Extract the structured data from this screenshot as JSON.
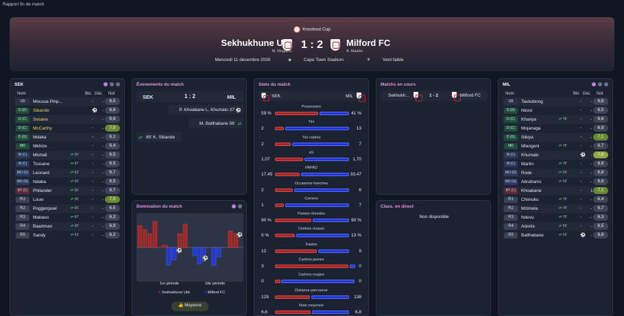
{
  "topbar": {
    "title": "Rapport fin de match"
  },
  "match": {
    "competition": "Knockout Cup",
    "home": "Sekhukhune Utd",
    "home_manager": "M. Mngqithi",
    "away": "Milford FC",
    "away_manager": "A. Maalim",
    "score": "1 : 2",
    "date": "Mercredi 11 décembre 2030",
    "stadium": "Cape Town Stadium",
    "weather": "Vent faible"
  },
  "home_panel": {
    "title": "SEK",
    "col_name": "Nom",
    "col_goals": "Bts",
    "col_dec": "Déc",
    "col_rating": "Not",
    "players": [
      {
        "pos": "GB",
        "name": "Moussa Pinp...",
        "sub": "",
        "bts": "-",
        "dec": "-",
        "rating": "6,5"
      },
      {
        "pos": "D (D)",
        "name": "Sibande",
        "sub": "",
        "bts": "⚽",
        "dec": "-",
        "rating": "6,6"
      },
      {
        "pos": "D (C)",
        "name": "Sesane",
        "sub": "",
        "bts": "-",
        "dec": "-",
        "rating": "6,6"
      },
      {
        "pos": "D (C)",
        "name": "McCarthy",
        "sub": "",
        "bts": "-",
        "dec": "-",
        "rating": "7,0"
      },
      {
        "pos": "D (G)",
        "name": "Mdaka",
        "sub": "",
        "bts": "-",
        "dec": "-",
        "rating": "6,1"
      },
      {
        "pos": "MD",
        "name": "Mkhize",
        "sub": "",
        "bts": "-",
        "dec": "-",
        "rating": "6,4"
      },
      {
        "pos": "M (C)",
        "name": "Mtshali",
        "sub": "56'",
        "bts": "-",
        "dec": "-",
        "rating": "6,5"
      },
      {
        "pos": "M (C)",
        "name": "Tsosane",
        "sub": "87'",
        "bts": "-",
        "dec": "-",
        "rating": "6,5"
      },
      {
        "pos": "MO (D)",
        "name": "Leonard",
        "sub": "63'",
        "bts": "-",
        "dec": "-",
        "rating": "6,7"
      },
      {
        "pos": "MO (G)",
        "name": "Ndaba",
        "sub": "56'",
        "bts": "-",
        "dec": "-",
        "rating": "6,5"
      },
      {
        "pos": "BT (C)",
        "name": "Philander",
        "sub": "56'",
        "bts": "-",
        "dec": "-",
        "rating": "6,7"
      },
      {
        "pos": "R1",
        "name": "Louw",
        "sub": "56'",
        "bts": "-",
        "dec": "-",
        "rating": "7,0"
      },
      {
        "pos": "R2",
        "name": "Poggenpoel",
        "sub": "56'",
        "bts": "-",
        "dec": "-",
        "rating": "6,5"
      },
      {
        "pos": "R3",
        "name": "Mabaso",
        "sub": "87'",
        "bts": "-",
        "dec": "-",
        "rating": "6,3"
      },
      {
        "pos": "R4",
        "name": "Baartman",
        "sub": "56'",
        "bts": "-",
        "dec": "-",
        "rating": "6,9"
      },
      {
        "pos": "R5",
        "name": "Sandy",
        "sub": "63'",
        "bts": "-",
        "dec": "-",
        "rating": "6,2"
      }
    ]
  },
  "events": {
    "title": "Évenements du match",
    "home": "SEK",
    "away": "MIL",
    "score": "1 : 2",
    "items": [
      {
        "side": "away",
        "text": "P. Khoabane L. Khumalo 37'"
      },
      {
        "side": "away",
        "text": "M. Batlhabane 56'"
      },
      {
        "side": "home",
        "text": "85' K. Sibande"
      }
    ]
  },
  "domination": {
    "title": "Domination du match",
    "half1": "1re période",
    "half2": "2de période",
    "legend_home": "Sekhukhune Utd",
    "legend_away": "Milford FC",
    "button": "Moyenne"
  },
  "stats": {
    "title": "Stats du match",
    "home": "SEK",
    "away": "MIL",
    "rows": [
      {
        "label": "Possession",
        "home": "59 %",
        "away": "41 %",
        "hv": 59,
        "av": 41
      },
      {
        "label": "Tirs",
        "home": "2",
        "away": "13",
        "hv": 2,
        "av": 13
      },
      {
        "label": "Tirs cadrés",
        "home": "2",
        "away": "7",
        "hv": 2,
        "av": 7
      },
      {
        "label": "xG",
        "home": "1,07",
        "away": "1,70",
        "hv": 1.07,
        "av": 1.7
      },
      {
        "label": "PAPAD",
        "home": "17,45",
        "away": "33,47",
        "hv": 17.45,
        "av": 33.47
      },
      {
        "label": "Occasions franches",
        "home": "2",
        "away": "6",
        "hv": 2,
        "av": 6
      },
      {
        "label": "Corners",
        "home": "1",
        "away": "7",
        "hv": 1,
        "av": 7
      },
      {
        "label": "Passes réussies",
        "home": "90 %",
        "away": "90 %",
        "hv": 90,
        "av": 90
      },
      {
        "label": "Centres réussis",
        "home": "5 %",
        "away": "13 %",
        "hv": 5,
        "av": 13
      },
      {
        "label": "Fautes",
        "home": "12",
        "away": "9",
        "hv": 12,
        "av": 9
      },
      {
        "label": "Cartons jaunes",
        "home": "3",
        "away": "0",
        "hv": 3,
        "av": 0
      },
      {
        "label": "Cartons rouges",
        "home": "0",
        "away": "0",
        "hv": 0,
        "av": 0
      },
      {
        "label": "Distance parcourue",
        "home": "129",
        "away": "138",
        "hv": 129,
        "av": 138
      },
      {
        "label": "Note moyenne",
        "home": "6,6",
        "away": "6,8",
        "hv": 6.6,
        "av": 6.8
      }
    ]
  },
  "live": {
    "title": "Matchs en cours",
    "home": "Sekhukh...",
    "score": "1 - 2",
    "away": "Milford FC"
  },
  "table": {
    "title": "Class. en direct",
    "text": "Non disponible"
  },
  "away_panel": {
    "title": "MIL",
    "col_name": "Nom",
    "col_goals": "Bts",
    "col_dec": "Déc",
    "col_rating": "Not",
    "players": [
      {
        "pos": "GB",
        "name": "Taukobong",
        "sub": "",
        "bts": "-",
        "dec": "-",
        "rating": "6,8"
      },
      {
        "pos": "D (D)",
        "name": "Nkosi",
        "sub": "",
        "bts": "-",
        "dec": "-",
        "rating": "6,5"
      },
      {
        "pos": "D (C)",
        "name": "Khanya",
        "sub": "78'",
        "bts": "-",
        "dec": "-",
        "rating": "6,6"
      },
      {
        "pos": "D (C)",
        "name": "Mojanaga",
        "sub": "",
        "bts": "-",
        "dec": "-",
        "rating": "6,9"
      },
      {
        "pos": "D (G)",
        "name": "Sibiya",
        "sub": "",
        "bts": "-",
        "dec": "-",
        "rating": "7,1"
      },
      {
        "pos": "MD",
        "name": "Mlangeni",
        "sub": "78'",
        "bts": "-",
        "dec": "-",
        "rating": "6,7"
      },
      {
        "pos": "M (C)",
        "name": "Khumalo",
        "sub": "",
        "bts": "⚽",
        "dec": "-",
        "rating": "7,8"
      },
      {
        "pos": "M (C)",
        "name": "Martin",
        "sub": "78'",
        "bts": "-",
        "dec": "-",
        "rating": "6,6"
      },
      {
        "pos": "MO (D)",
        "name": "Rode",
        "sub": "59'",
        "bts": "-",
        "dec": "-",
        "rating": "6,8"
      },
      {
        "pos": "MO (G)",
        "name": "Abrahams",
        "sub": "59'",
        "bts": "-",
        "dec": "-",
        "rating": "6,6"
      },
      {
        "pos": "BT (C)",
        "name": "Khoabane",
        "sub": "",
        "bts": "-",
        "dec": "1",
        "rating": "7,1"
      },
      {
        "pos": "R1",
        "name": "Chimuku",
        "sub": "78'",
        "bts": "-",
        "dec": "-",
        "rating": "6,4"
      },
      {
        "pos": "R2",
        "name": "Mzimela",
        "sub": "78'",
        "bts": "-",
        "dec": "-",
        "rating": "6,7"
      },
      {
        "pos": "R3",
        "name": "Ndevu",
        "sub": "78'",
        "bts": "-",
        "dec": "-",
        "rating": "6,3"
      },
      {
        "pos": "R4",
        "name": "Adonis",
        "sub": "59'",
        "bts": "-",
        "dec": "-",
        "rating": "6,5"
      },
      {
        "pos": "R5",
        "name": "Batlhabane",
        "sub": "59'",
        "bts": "⚽",
        "dec": "-",
        "rating": "6,8"
      }
    ]
  },
  "colors": {
    "home": "#b02a2a",
    "away": "#1f35d6",
    "accent": "#c77de0"
  }
}
